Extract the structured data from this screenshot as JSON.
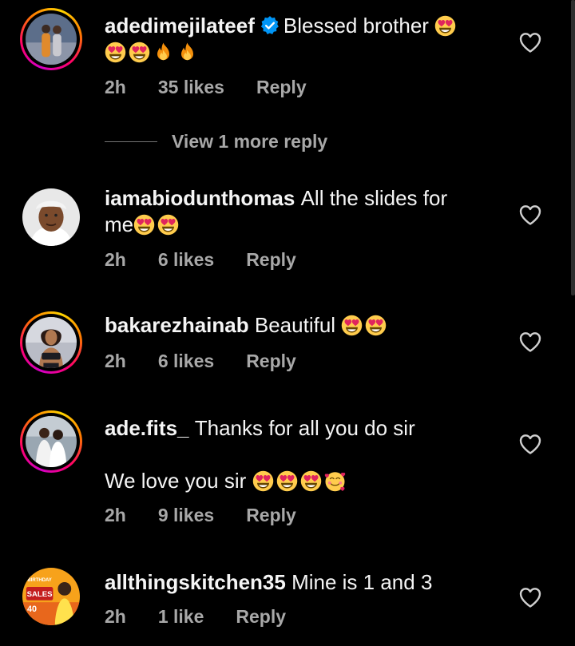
{
  "comments": [
    {
      "username": "adedimejilateef",
      "verified": true,
      "text": "Blessed brother",
      "time": "2h",
      "likes": "35 likes",
      "reply": "Reply"
    },
    {
      "username": "iamabiodunthomas",
      "text": "All the slides for",
      "text2": "me",
      "time": "2h",
      "likes": "6 likes",
      "reply": "Reply"
    },
    {
      "username": "bakarezhainab",
      "text": "Beautiful",
      "time": "2h",
      "likes": "6 likes",
      "reply": "Reply"
    },
    {
      "username": "ade.fits_",
      "text": "Thanks for all you do sir",
      "text2": "We love you sir",
      "time": "2h",
      "likes": "9 likes",
      "reply": "Reply"
    },
    {
      "username": "allthingskitchen35",
      "text": "Mine is 1 and 3",
      "time": "2h",
      "likes": "1 like",
      "reply": "Reply"
    }
  ],
  "view_more_replies": "View 1 more reply",
  "avatar5_text": {
    "line1": "BIRTHDAY",
    "line2": "SALES",
    "line3": "40"
  },
  "icons": {
    "verified": "verified-badge-icon",
    "heart": "heart-outline-icon",
    "heart_eyes": "heart-eyes-emoji",
    "fire": "fire-emoji",
    "smiling_hearts": "smiling-face-with-hearts-emoji"
  },
  "colors": {
    "background": "#000000",
    "text": "#f5f5f5",
    "secondary": "#a8a8a8",
    "verified": "#0095f6"
  }
}
